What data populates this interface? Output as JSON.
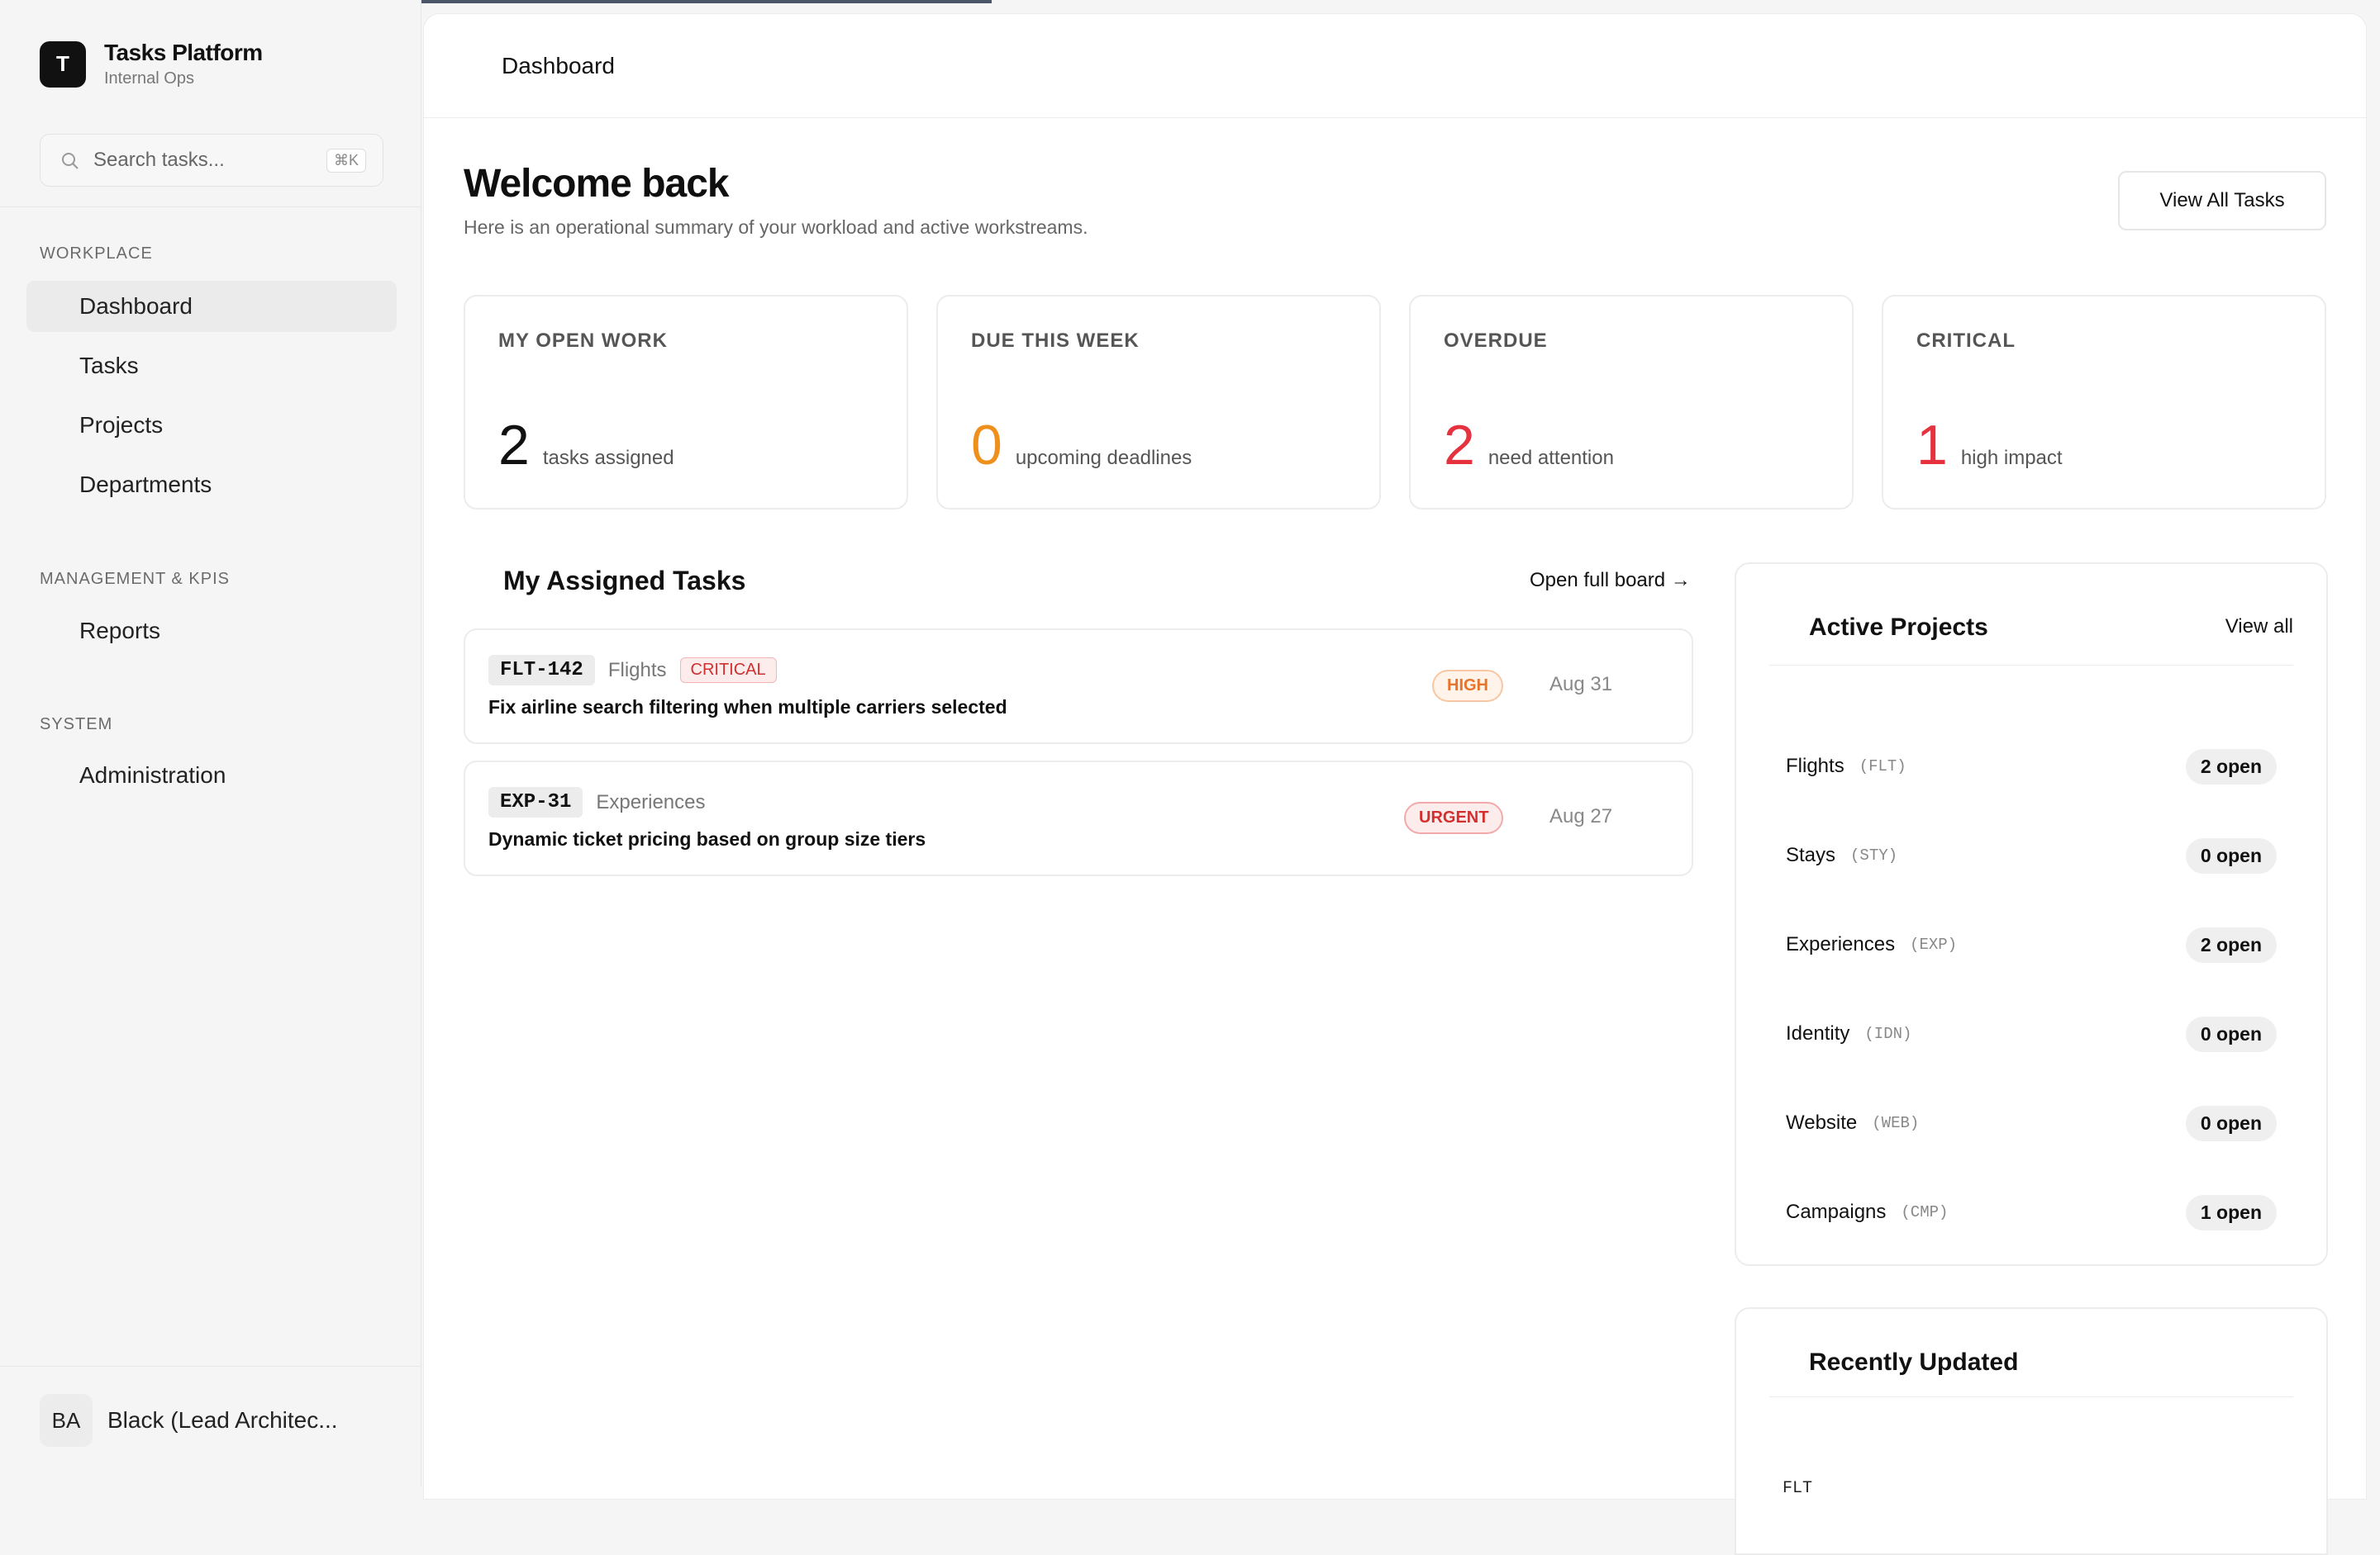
{
  "app": {
    "logo_letter": "T",
    "title": "Tasks Platform",
    "subtitle": "Internal Ops"
  },
  "search": {
    "placeholder": "Search tasks...",
    "shortcut": "⌘K"
  },
  "sidebar": {
    "sections": [
      {
        "label": "WORKPLACE",
        "items": [
          "Dashboard",
          "Tasks",
          "Projects",
          "Departments"
        ]
      },
      {
        "label": "MANAGEMENT & KPIS",
        "items": [
          "Reports"
        ]
      },
      {
        "label": "SYSTEM",
        "items": [
          "Administration"
        ]
      }
    ],
    "active": "Dashboard"
  },
  "user": {
    "initials": "BA",
    "name": "Black (Lead Architec..."
  },
  "header": {
    "breadcrumb": "Dashboard"
  },
  "welcome": {
    "title": "Welcome back",
    "subtitle": "Here is an operational summary of your workload and active workstreams.",
    "view_all_button": "View All Tasks"
  },
  "stats": [
    {
      "label": "MY OPEN WORK",
      "value": "2",
      "sub": "tasks assigned",
      "color": "#111111"
    },
    {
      "label": "DUE THIS WEEK",
      "value": "0",
      "sub": "upcoming deadlines",
      "color": "#f0901c"
    },
    {
      "label": "OVERDUE",
      "value": "2",
      "sub": "need attention",
      "color": "#e5323e"
    },
    {
      "label": "CRITICAL",
      "value": "1",
      "sub": "high impact",
      "color": "#e5323e"
    }
  ],
  "tasks": {
    "title": "My Assigned Tasks",
    "board_link": "Open full board →",
    "items": [
      {
        "id": "FLT-142",
        "project": "Flights",
        "tag": "CRITICAL",
        "title": "Fix airline search filtering when multiple carriers selected",
        "priority": "HIGH",
        "due": "Aug 31"
      },
      {
        "id": "EXP-31",
        "project": "Experiences",
        "tag": "",
        "title": "Dynamic ticket pricing based on group size tiers",
        "priority": "URGENT",
        "due": "Aug 27"
      }
    ]
  },
  "active_projects": {
    "title": "Active Projects",
    "view_all": "View all",
    "items": [
      {
        "name": "Flights",
        "key": "(FLT)",
        "count": "2 open"
      },
      {
        "name": "Stays",
        "key": "(STY)",
        "count": "0 open"
      },
      {
        "name": "Experiences",
        "key": "(EXP)",
        "count": "2 open"
      },
      {
        "name": "Identity",
        "key": "(IDN)",
        "count": "0 open"
      },
      {
        "name": "Website",
        "key": "(WEB)",
        "count": "0 open"
      },
      {
        "name": "Campaigns",
        "key": "(CMP)",
        "count": "1 open"
      }
    ]
  },
  "recently_updated": {
    "title": "Recently Updated",
    "first_item_partial": "FLT"
  }
}
